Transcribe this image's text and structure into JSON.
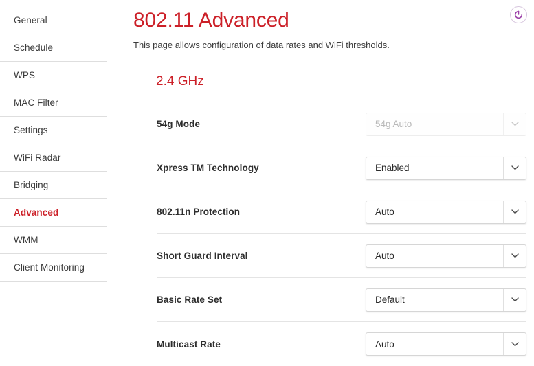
{
  "sidebar": {
    "items": [
      {
        "label": "General",
        "active": false
      },
      {
        "label": "Schedule",
        "active": false
      },
      {
        "label": "WPS",
        "active": false
      },
      {
        "label": "MAC Filter",
        "active": false
      },
      {
        "label": "Settings",
        "active": false
      },
      {
        "label": "WiFi Radar",
        "active": false
      },
      {
        "label": "Bridging",
        "active": false
      },
      {
        "label": "Advanced",
        "active": true
      },
      {
        "label": "WMM",
        "active": false
      },
      {
        "label": "Client Monitoring",
        "active": false
      }
    ]
  },
  "header": {
    "title": "802.11 Advanced",
    "description": "This page allows configuration of data rates and WiFi thresholds.",
    "refresh_icon": "refresh-icon"
  },
  "section": {
    "band_title": "2.4 GHz"
  },
  "form": {
    "rows": [
      {
        "label": "54g Mode",
        "value": "54g Auto",
        "disabled": true
      },
      {
        "label": "Xpress TM Technology",
        "value": "Enabled",
        "disabled": false
      },
      {
        "label": "802.11n Protection",
        "value": "Auto",
        "disabled": false
      },
      {
        "label": "Short Guard Interval",
        "value": "Auto",
        "disabled": false
      },
      {
        "label": "Basic Rate Set",
        "value": "Default",
        "disabled": false
      },
      {
        "label": "Multicast Rate",
        "value": "Auto",
        "disabled": false
      }
    ]
  },
  "colors": {
    "brand_red": "#cc2028",
    "refresh_purple": "#9b3fa8",
    "divider": "#dedede",
    "text": "#2e2e2e"
  }
}
